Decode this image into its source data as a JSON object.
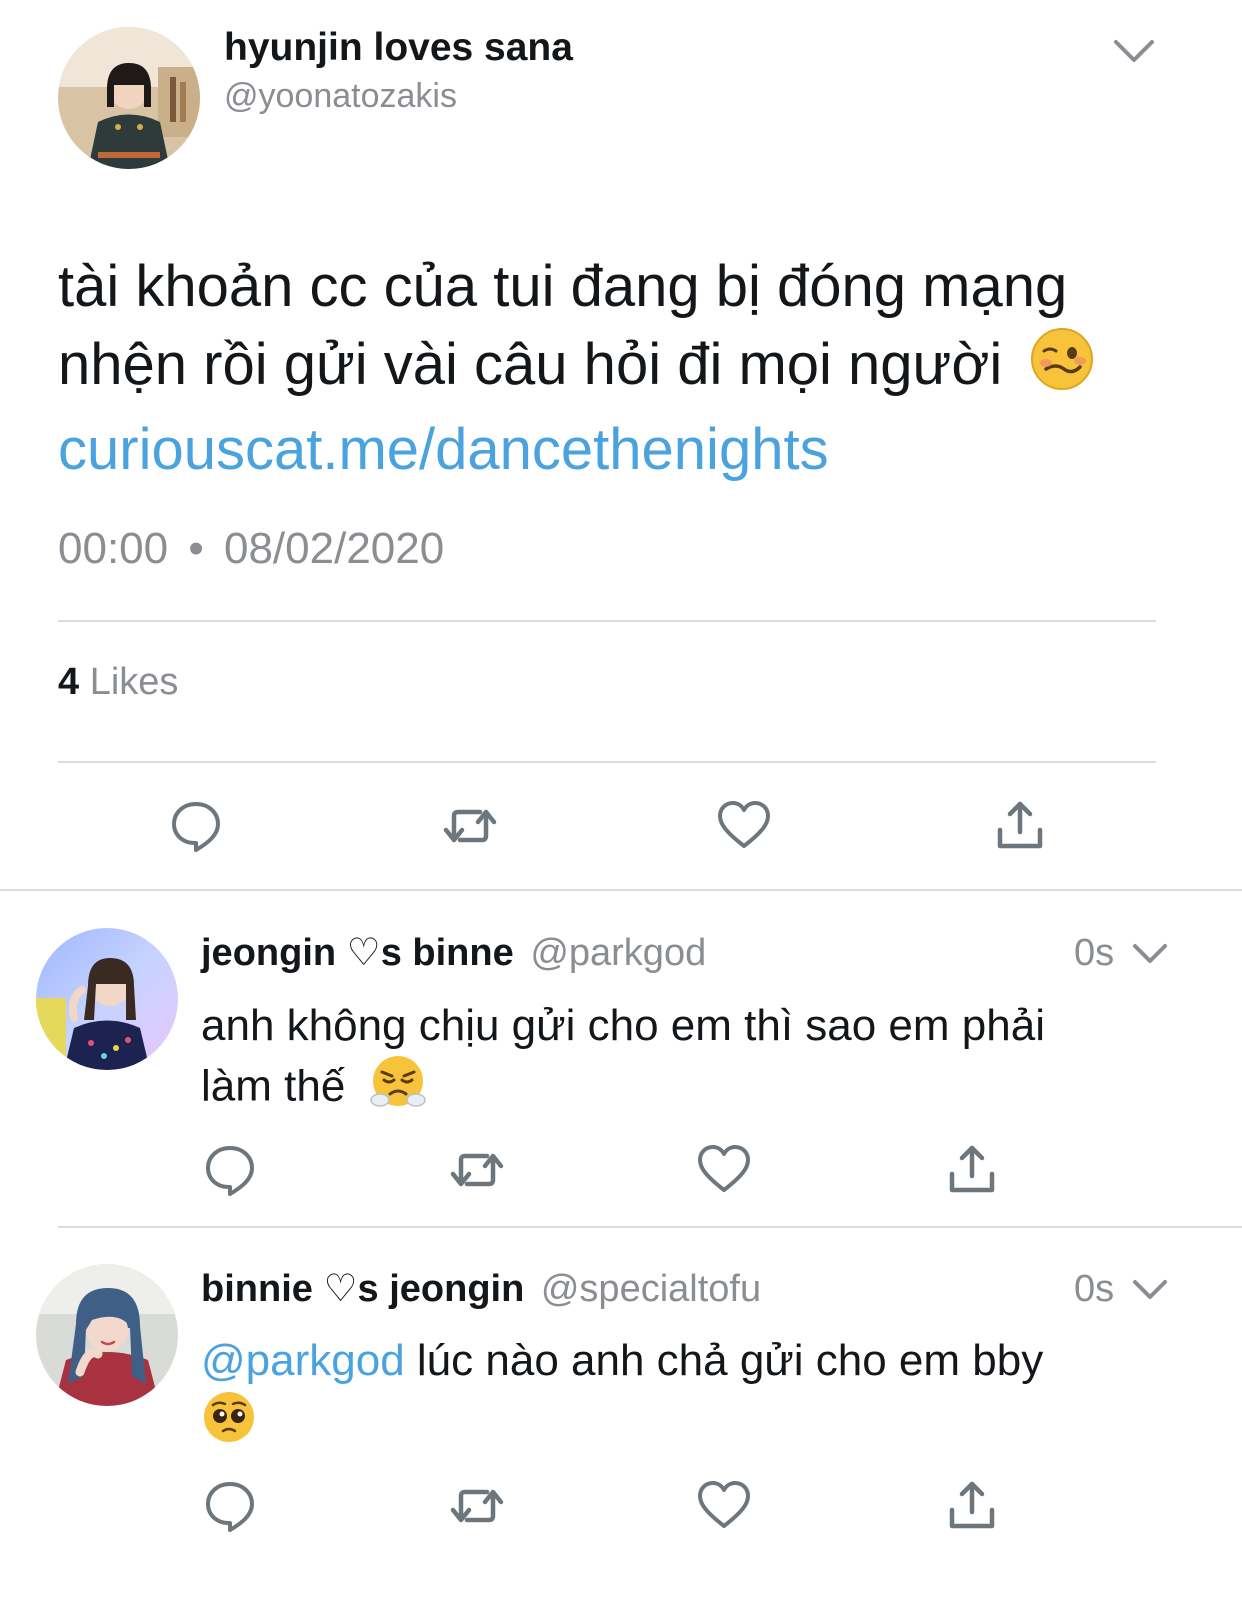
{
  "main_tweet": {
    "display_name": "hyunjin loves sana",
    "handle": "@yoonatozakis",
    "text_line1": "tài khoản cc của tui đang bị đóng mạng",
    "text_line2": "nhện rồi gửi vài câu hỏi đi mọi người",
    "link": "curiouscat.me/dancethenights",
    "time": "00:00",
    "separator": "•",
    "date": "08/02/2020",
    "likes_count": "4",
    "likes_label": "Likes",
    "emoji": "woozy-face"
  },
  "replies": [
    {
      "display_name": "jeongin ♡s binne",
      "handle": "@parkgod",
      "time": "0s",
      "text_line1": "anh không chịu gửi cho em thì sao em phải",
      "text_line2": "làm thế",
      "emoji": "face-with-steam"
    },
    {
      "display_name": "binnie ♡s jeongin",
      "handle": "@specialtofu",
      "time": "0s",
      "mention": "@parkgod",
      "text_line1": "lúc nào anh chả gửi cho em bby",
      "emoji": "pleading-face"
    }
  ],
  "colors": {
    "link": "#4aa3df",
    "muted": "#8a8d91",
    "icon": "#6e767d"
  }
}
